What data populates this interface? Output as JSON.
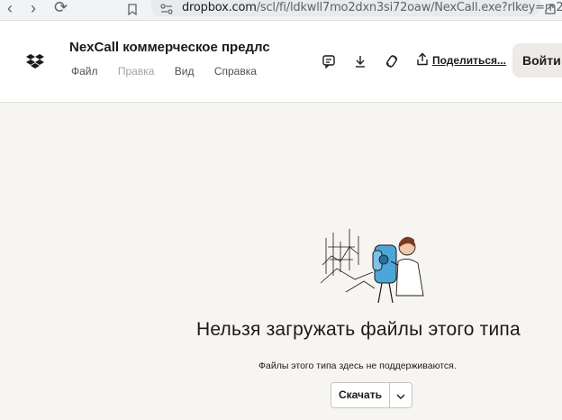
{
  "browser": {
    "url_host": "dropbox.com",
    "url_path": "/scl/fi/ldkwll7mo2dxn3si72oaw/NexCall.exe?rlkey=m2..."
  },
  "header": {
    "doc_title": "NexCall коммерческое предлс",
    "menu": [
      "Файл",
      "Правка",
      "Вид",
      "Справка"
    ],
    "share_label": "Поделиться...",
    "login_label": "Войти"
  },
  "main": {
    "headline": "Нельзя загружать файлы этого типа",
    "subtext": "Файлы этого типа здесь не поддерживаются.",
    "download_label": "Скачать"
  },
  "colors": {
    "page_bg": "#f7f5f2",
    "header_bg": "#ffffff",
    "illustration_accent": "#4da6d8"
  }
}
